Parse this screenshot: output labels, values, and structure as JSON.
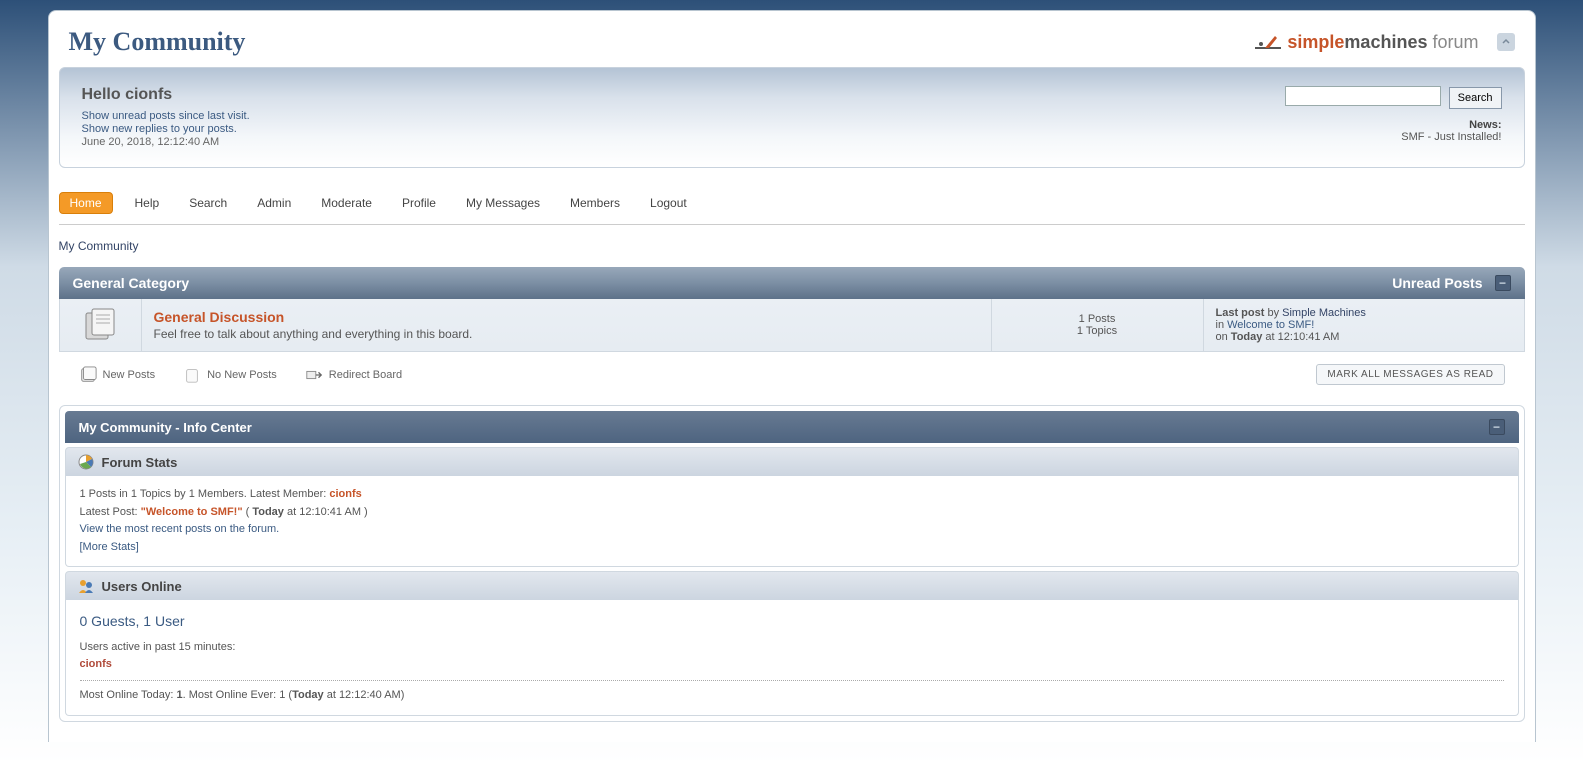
{
  "site": {
    "title": "My Community"
  },
  "logo": {
    "part1": "simple",
    "part2": "machines",
    "part3": "forum"
  },
  "greeting": "Hello cionfs",
  "user_links": {
    "unread": "Show unread posts since last visit.",
    "replies": "Show new replies to your posts.",
    "datetime": "June 20, 2018, 12:12:40 AM"
  },
  "search": {
    "button": "Search"
  },
  "news": {
    "label": "News:",
    "text": "SMF - Just Installed!"
  },
  "menu": [
    "Home",
    "Help",
    "Search",
    "Admin",
    "Moderate",
    "Profile",
    "My Messages",
    "Members",
    "Logout"
  ],
  "breadcrumb": "My Community",
  "category": {
    "name": "General Category",
    "unread_label": "Unread Posts"
  },
  "board": {
    "title": "General Discussion",
    "desc": "Feel free to talk about anything and everything in this board.",
    "posts": "1 Posts",
    "topics": "1 Topics",
    "last_post_label": "Last post",
    "by_label": " by ",
    "author": "Simple Machines",
    "in_label": "in ",
    "topic_link": "Welcome to SMF!",
    "on_label": "on ",
    "today_label": "Today",
    "at_time": " at 12:10:41 AM"
  },
  "legend": {
    "new_posts": "New Posts",
    "no_new_posts": "No New Posts",
    "redirect": "Redirect Board",
    "mark_read": "MARK ALL MESSAGES AS READ"
  },
  "info_center": {
    "title": "My Community - Info Center",
    "forum_stats": {
      "title": "Forum Stats",
      "line1_a": "1 Posts in 1 Topics by 1 Members. Latest Member: ",
      "latest_member": "cionfs",
      "latest_post_label": "Latest Post: ",
      "latest_post_link": "\"Welcome to SMF!\"",
      "paren_open": " ( ",
      "today": "Today",
      "at_time": " at 12:10:41 AM )",
      "recent_link": "View the most recent posts on the forum.",
      "more_stats": "[More Stats]"
    },
    "users_online": {
      "title": "Users Online",
      "guests_line": "0 Guests, 1 User",
      "active_label": "Users active in past 15 minutes:",
      "user": "cionfs",
      "most_a": "Most Online Today: ",
      "most_val": "1",
      "most_b": ". Most Online Ever: 1 (",
      "today": "Today",
      "most_c": " at 12:12:40 AM)"
    }
  }
}
